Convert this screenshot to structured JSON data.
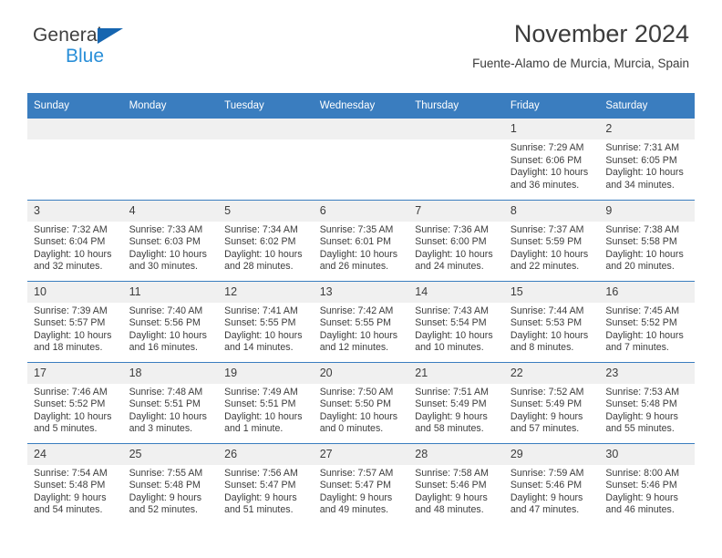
{
  "brand": {
    "name_part1": "General",
    "name_part2": "Blue",
    "triangle_icon": "brand-triangle-icon",
    "colors": {
      "dark": "#3f3f3f",
      "blue": "#2a8fd8",
      "triangle": "#1565b0"
    }
  },
  "header": {
    "title": "November 2024",
    "subtitle": "Fuente-Alamo de Murcia, Murcia, Spain"
  },
  "theme": {
    "header_row_bg": "#3a7dbf",
    "daynum_bg": "#f0f0f0",
    "text": "#3c3c3c"
  },
  "weekdays": [
    "Sunday",
    "Monday",
    "Tuesday",
    "Wednesday",
    "Thursday",
    "Friday",
    "Saturday"
  ],
  "labels": {
    "sunrise_prefix": "Sunrise: ",
    "sunset_prefix": "Sunset: ",
    "daylight_prefix": "Daylight: "
  },
  "weeks": [
    [
      {
        "day": "",
        "empty": true
      },
      {
        "day": "",
        "empty": true
      },
      {
        "day": "",
        "empty": true
      },
      {
        "day": "",
        "empty": true
      },
      {
        "day": "",
        "empty": true
      },
      {
        "day": "1",
        "sunrise": "Sunrise: 7:29 AM",
        "sunset": "Sunset: 6:06 PM",
        "daylight_line1": "Daylight: 10 hours",
        "daylight_line2": "and 36 minutes."
      },
      {
        "day": "2",
        "sunrise": "Sunrise: 7:31 AM",
        "sunset": "Sunset: 6:05 PM",
        "daylight_line1": "Daylight: 10 hours",
        "daylight_line2": "and 34 minutes."
      }
    ],
    [
      {
        "day": "3",
        "sunrise": "Sunrise: 7:32 AM",
        "sunset": "Sunset: 6:04 PM",
        "daylight_line1": "Daylight: 10 hours",
        "daylight_line2": "and 32 minutes."
      },
      {
        "day": "4",
        "sunrise": "Sunrise: 7:33 AM",
        "sunset": "Sunset: 6:03 PM",
        "daylight_line1": "Daylight: 10 hours",
        "daylight_line2": "and 30 minutes."
      },
      {
        "day": "5",
        "sunrise": "Sunrise: 7:34 AM",
        "sunset": "Sunset: 6:02 PM",
        "daylight_line1": "Daylight: 10 hours",
        "daylight_line2": "and 28 minutes."
      },
      {
        "day": "6",
        "sunrise": "Sunrise: 7:35 AM",
        "sunset": "Sunset: 6:01 PM",
        "daylight_line1": "Daylight: 10 hours",
        "daylight_line2": "and 26 minutes."
      },
      {
        "day": "7",
        "sunrise": "Sunrise: 7:36 AM",
        "sunset": "Sunset: 6:00 PM",
        "daylight_line1": "Daylight: 10 hours",
        "daylight_line2": "and 24 minutes."
      },
      {
        "day": "8",
        "sunrise": "Sunrise: 7:37 AM",
        "sunset": "Sunset: 5:59 PM",
        "daylight_line1": "Daylight: 10 hours",
        "daylight_line2": "and 22 minutes."
      },
      {
        "day": "9",
        "sunrise": "Sunrise: 7:38 AM",
        "sunset": "Sunset: 5:58 PM",
        "daylight_line1": "Daylight: 10 hours",
        "daylight_line2": "and 20 minutes."
      }
    ],
    [
      {
        "day": "10",
        "sunrise": "Sunrise: 7:39 AM",
        "sunset": "Sunset: 5:57 PM",
        "daylight_line1": "Daylight: 10 hours",
        "daylight_line2": "and 18 minutes."
      },
      {
        "day": "11",
        "sunrise": "Sunrise: 7:40 AM",
        "sunset": "Sunset: 5:56 PM",
        "daylight_line1": "Daylight: 10 hours",
        "daylight_line2": "and 16 minutes."
      },
      {
        "day": "12",
        "sunrise": "Sunrise: 7:41 AM",
        "sunset": "Sunset: 5:55 PM",
        "daylight_line1": "Daylight: 10 hours",
        "daylight_line2": "and 14 minutes."
      },
      {
        "day": "13",
        "sunrise": "Sunrise: 7:42 AM",
        "sunset": "Sunset: 5:55 PM",
        "daylight_line1": "Daylight: 10 hours",
        "daylight_line2": "and 12 minutes."
      },
      {
        "day": "14",
        "sunrise": "Sunrise: 7:43 AM",
        "sunset": "Sunset: 5:54 PM",
        "daylight_line1": "Daylight: 10 hours",
        "daylight_line2": "and 10 minutes."
      },
      {
        "day": "15",
        "sunrise": "Sunrise: 7:44 AM",
        "sunset": "Sunset: 5:53 PM",
        "daylight_line1": "Daylight: 10 hours",
        "daylight_line2": "and 8 minutes."
      },
      {
        "day": "16",
        "sunrise": "Sunrise: 7:45 AM",
        "sunset": "Sunset: 5:52 PM",
        "daylight_line1": "Daylight: 10 hours",
        "daylight_line2": "and 7 minutes."
      }
    ],
    [
      {
        "day": "17",
        "sunrise": "Sunrise: 7:46 AM",
        "sunset": "Sunset: 5:52 PM",
        "daylight_line1": "Daylight: 10 hours",
        "daylight_line2": "and 5 minutes."
      },
      {
        "day": "18",
        "sunrise": "Sunrise: 7:48 AM",
        "sunset": "Sunset: 5:51 PM",
        "daylight_line1": "Daylight: 10 hours",
        "daylight_line2": "and 3 minutes."
      },
      {
        "day": "19",
        "sunrise": "Sunrise: 7:49 AM",
        "sunset": "Sunset: 5:51 PM",
        "daylight_line1": "Daylight: 10 hours",
        "daylight_line2": "and 1 minute."
      },
      {
        "day": "20",
        "sunrise": "Sunrise: 7:50 AM",
        "sunset": "Sunset: 5:50 PM",
        "daylight_line1": "Daylight: 10 hours",
        "daylight_line2": "and 0 minutes."
      },
      {
        "day": "21",
        "sunrise": "Sunrise: 7:51 AM",
        "sunset": "Sunset: 5:49 PM",
        "daylight_line1": "Daylight: 9 hours",
        "daylight_line2": "and 58 minutes."
      },
      {
        "day": "22",
        "sunrise": "Sunrise: 7:52 AM",
        "sunset": "Sunset: 5:49 PM",
        "daylight_line1": "Daylight: 9 hours",
        "daylight_line2": "and 57 minutes."
      },
      {
        "day": "23",
        "sunrise": "Sunrise: 7:53 AM",
        "sunset": "Sunset: 5:48 PM",
        "daylight_line1": "Daylight: 9 hours",
        "daylight_line2": "and 55 minutes."
      }
    ],
    [
      {
        "day": "24",
        "sunrise": "Sunrise: 7:54 AM",
        "sunset": "Sunset: 5:48 PM",
        "daylight_line1": "Daylight: 9 hours",
        "daylight_line2": "and 54 minutes."
      },
      {
        "day": "25",
        "sunrise": "Sunrise: 7:55 AM",
        "sunset": "Sunset: 5:48 PM",
        "daylight_line1": "Daylight: 9 hours",
        "daylight_line2": "and 52 minutes."
      },
      {
        "day": "26",
        "sunrise": "Sunrise: 7:56 AM",
        "sunset": "Sunset: 5:47 PM",
        "daylight_line1": "Daylight: 9 hours",
        "daylight_line2": "and 51 minutes."
      },
      {
        "day": "27",
        "sunrise": "Sunrise: 7:57 AM",
        "sunset": "Sunset: 5:47 PM",
        "daylight_line1": "Daylight: 9 hours",
        "daylight_line2": "and 49 minutes."
      },
      {
        "day": "28",
        "sunrise": "Sunrise: 7:58 AM",
        "sunset": "Sunset: 5:46 PM",
        "daylight_line1": "Daylight: 9 hours",
        "daylight_line2": "and 48 minutes."
      },
      {
        "day": "29",
        "sunrise": "Sunrise: 7:59 AM",
        "sunset": "Sunset: 5:46 PM",
        "daylight_line1": "Daylight: 9 hours",
        "daylight_line2": "and 47 minutes."
      },
      {
        "day": "30",
        "sunrise": "Sunrise: 8:00 AM",
        "sunset": "Sunset: 5:46 PM",
        "daylight_line1": "Daylight: 9 hours",
        "daylight_line2": "and 46 minutes."
      }
    ]
  ]
}
